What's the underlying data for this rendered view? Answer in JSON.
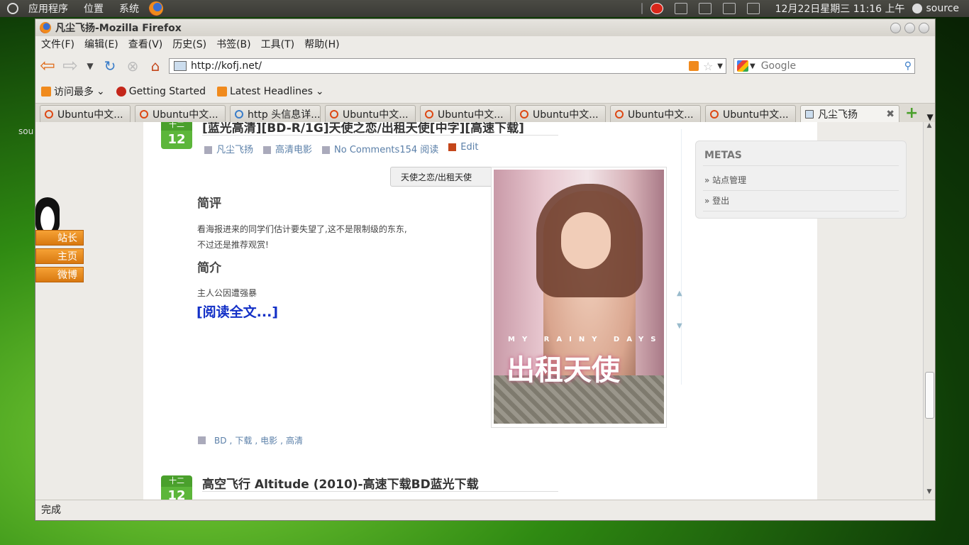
{
  "top_panel": {
    "menus": [
      "应用程序",
      "位置",
      "系统"
    ],
    "clock": "12月22日星期三 11:16 上午",
    "user": "source"
  },
  "desktop_label": "sou",
  "window": {
    "title": "凡尘飞扬-Mozilla Firefox",
    "menus": [
      "文件(F)",
      "编辑(E)",
      "查看(V)",
      "历史(S)",
      "书签(B)",
      "工具(T)",
      "帮助(H)"
    ],
    "url": "http://kofj.net/",
    "search_placeholder": "Google",
    "bookmarks": [
      "访问最多",
      "Getting Started",
      "Latest Headlines"
    ],
    "tabs": [
      "Ubuntu中文...",
      "Ubuntu中文...",
      "http 头信息详...",
      "Ubuntu中文...",
      "Ubuntu中文...",
      "Ubuntu中文...",
      "Ubuntu中文...",
      "Ubuntu中文...",
      "凡尘飞扬"
    ],
    "status": "完成"
  },
  "page": {
    "post1": {
      "month": "十二",
      "day": "12",
      "title": "[蓝光高清][BD-R/1G]天使之恋/出租天使[中字][高速下载]",
      "author": "凡尘飞扬",
      "category": "高清电影",
      "comments": "No Comments",
      "reads": "154 阅读",
      "edit": "Edit",
      "tooltip": "天使之恋/出租天使",
      "review_heading": "简评",
      "review_text_1": "看海报进来的同学们估计要失望了,这不是限制级的东东,",
      "review_text_2": "不过还是推荐观赏!",
      "intro_heading": "简介",
      "intro_text": "主人公因遭强暴",
      "read_more": "[阅读全文...]",
      "poster_subtitle": "MY RAINY DAYS",
      "poster_title": "出租天使",
      "tags": [
        "BD",
        ",",
        "下载",
        ",",
        "电影",
        ",",
        "高清"
      ]
    },
    "post2": {
      "month": "十二",
      "day": "12",
      "title": "高空飞行 Altitude (2010)-高速下载BD蓝光下载"
    },
    "metas": {
      "title": "METAS",
      "items": [
        "» 站点管理",
        "» 登出"
      ]
    },
    "qq_widget": {
      "buttons": [
        "站长",
        "主页",
        "微博"
      ]
    }
  }
}
